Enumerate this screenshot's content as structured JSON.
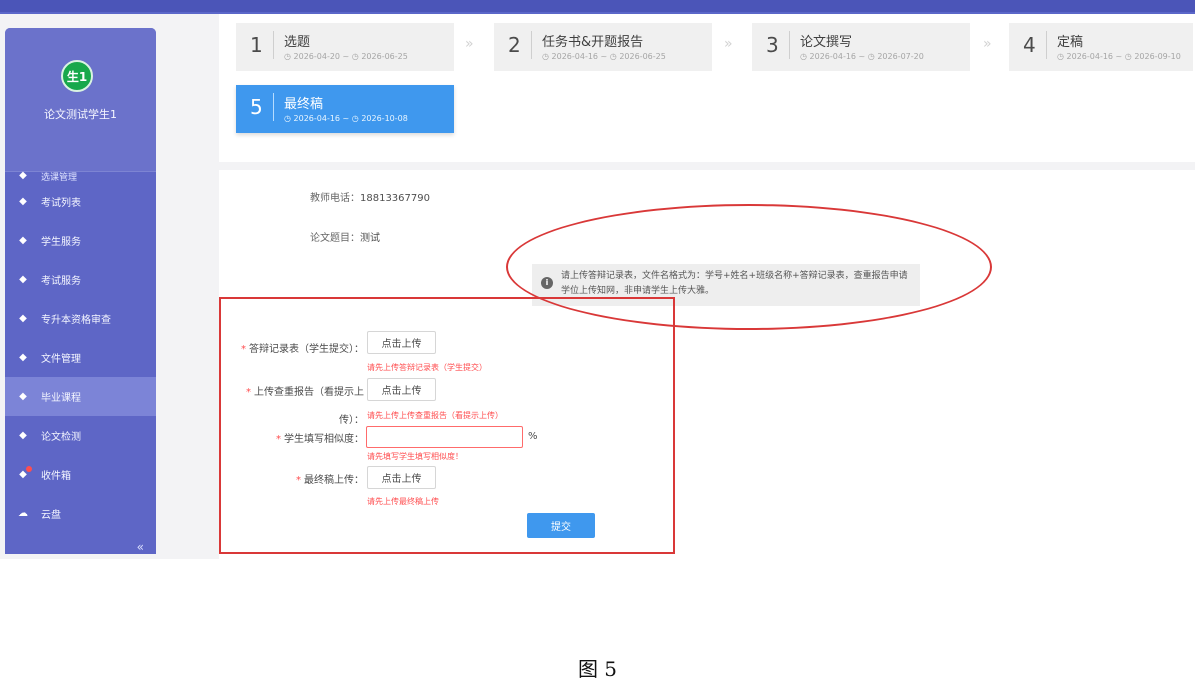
{
  "sidebar": {
    "avatar_text": "生1",
    "user_name": "论文测试学生1",
    "items": [
      {
        "label": "选课管理",
        "icon": "nav-icon",
        "partial": true
      },
      {
        "label": "考试列表",
        "icon": "nav-icon"
      },
      {
        "label": "学生服务",
        "icon": "nav-icon"
      },
      {
        "label": "考试服务",
        "icon": "nav-icon"
      },
      {
        "label": "专升本资格审查",
        "icon": "nav-icon"
      },
      {
        "label": "文件管理",
        "icon": "nav-icon"
      },
      {
        "label": "毕业课程",
        "icon": "nav-icon",
        "active": true
      },
      {
        "label": "论文检测",
        "icon": "nav-icon"
      },
      {
        "label": "收件箱",
        "icon": "inbox-icon",
        "badge": true
      },
      {
        "label": "云盘",
        "icon": "cloud-icon"
      }
    ],
    "collapse_text": "«"
  },
  "steps": [
    {
      "num": "1",
      "title": "选题",
      "date": "◷ 2026-04-20 ~ ◷ 2026-06-25"
    },
    {
      "num": "2",
      "title": "任务书&开题报告",
      "date": "◷ 2026-04-16 ~ ◷ 2026-06-25"
    },
    {
      "num": "3",
      "title": "论文撰写",
      "date": "◷ 2026-04-16 ~ ◷ 2026-07-20"
    },
    {
      "num": "4",
      "title": "定稿",
      "date": "◷ 2026-04-16 ~ ◷ 2026-09-10"
    },
    {
      "num": "5",
      "title": "最终稿",
      "date": "◷ 2026-04-16 ~ ◷ 2026-10-08",
      "active": true
    }
  ],
  "info": {
    "teacher_phone_label": "教师电话：",
    "teacher_phone": "18813367790",
    "thesis_title_label": "论文题目：",
    "thesis_title": "测试"
  },
  "notice": "请上传答辩记录表，文件名格式为：学号+姓名+班级名称+答辩记录表，查重报告申请学位上传知网，非申请学生上传大雅。",
  "form": {
    "defense_record_label": "答辩记录表（学生提交）：",
    "defense_record_button": "点击上传",
    "defense_record_error": "请先上传答辩记录表（学生提交）",
    "plagiarism_report_label": "上传查重报告（看提示上传）：",
    "plagiarism_report_button": "点击上传",
    "plagiarism_report_error": "请先上传上传查重报告（看提示上传）",
    "similarity_label": "学生填写相似度：",
    "similarity_value": "",
    "similarity_unit": "%",
    "similarity_error": "请先填写学生填写相似度！",
    "final_upload_label": "最终稿上传：",
    "final_upload_button": "点击上传",
    "final_upload_error": "请先上传最终稿上传",
    "submit_label": "提交"
  },
  "caption": "图 5",
  "colors": {
    "topbar": "#4b55b8",
    "sidebar": "#5e66c6",
    "active_step": "#3f98ee",
    "error": "#ff4d4f",
    "annotation_red": "#d93838"
  }
}
